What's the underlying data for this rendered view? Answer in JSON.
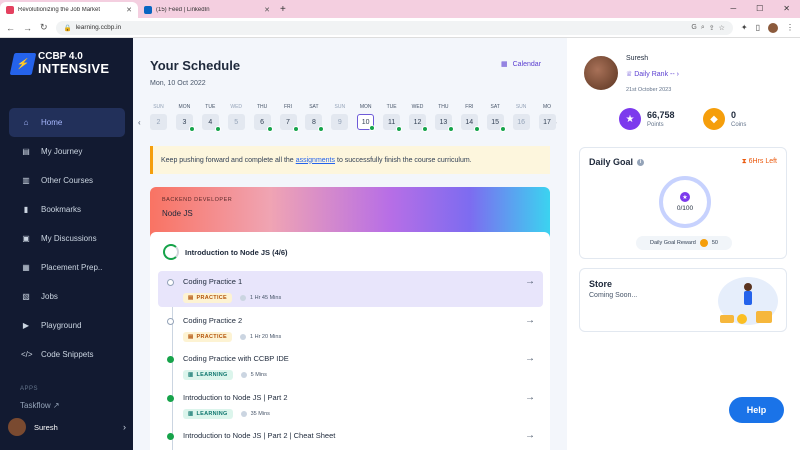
{
  "browser": {
    "tabs": [
      {
        "title": "Revolutionizing the Job Market",
        "active": true,
        "favicon_color": "#e4405f"
      },
      {
        "title": "(15) Feed | LinkedIn",
        "active": false,
        "favicon_color": "#0a66c2"
      }
    ],
    "url": "learning.ccbp.in"
  },
  "sidebar": {
    "logo": {
      "line1": "CCBP 4.0",
      "line2": "INTENSIVE"
    },
    "items": [
      {
        "label": "Home",
        "icon": "home-icon",
        "glyph": "⌂",
        "active": true
      },
      {
        "label": "My Journey",
        "icon": "journey-icon",
        "glyph": "▤"
      },
      {
        "label": "Other Courses",
        "icon": "book-icon",
        "glyph": "▥"
      },
      {
        "label": "Bookmarks",
        "icon": "bookmark-icon",
        "glyph": "▮"
      },
      {
        "label": "My Discussions",
        "icon": "chat-icon",
        "glyph": "▣"
      },
      {
        "label": "Placement Prep..",
        "icon": "placement-icon",
        "glyph": "▦"
      },
      {
        "label": "Jobs",
        "icon": "briefcase-icon",
        "glyph": "▧"
      },
      {
        "label": "Playground",
        "icon": "terminal-icon",
        "glyph": "▶"
      },
      {
        "label": "Code Snippets",
        "icon": "code-icon",
        "glyph": "</>"
      }
    ],
    "apps_label": "APPS",
    "apps_item": "Taskflow",
    "user": "Suresh"
  },
  "schedule": {
    "title": "Your Schedule",
    "date": "Mon, 10 Oct 2022",
    "calendar_label": "Calendar",
    "days": [
      {
        "dow": "SUN",
        "num": "2",
        "done": false,
        "dim": true
      },
      {
        "dow": "MON",
        "num": "3",
        "done": true
      },
      {
        "dow": "TUE",
        "num": "4",
        "done": true
      },
      {
        "dow": "WED",
        "num": "5",
        "done": false,
        "dim": true
      },
      {
        "dow": "THU",
        "num": "6",
        "done": true
      },
      {
        "dow": "FRI",
        "num": "7",
        "done": true
      },
      {
        "dow": "SAT",
        "num": "8",
        "done": true
      },
      {
        "dow": "SUN",
        "num": "9",
        "done": false,
        "dim": true
      },
      {
        "dow": "MON",
        "num": "10",
        "done": true,
        "today": true
      },
      {
        "dow": "TUE",
        "num": "11",
        "done": true
      },
      {
        "dow": "WED",
        "num": "12",
        "done": true
      },
      {
        "dow": "THU",
        "num": "13",
        "done": true
      },
      {
        "dow": "FRI",
        "num": "14",
        "done": true
      },
      {
        "dow": "SAT",
        "num": "15",
        "done": true
      },
      {
        "dow": "SUN",
        "num": "16",
        "done": false,
        "dim": true
      },
      {
        "dow": "MO",
        "num": "17",
        "done": false
      }
    ],
    "notice": {
      "before": "Keep pushing forward and complete all the",
      "link": "assignments",
      "after": "to successfully finish the course curriculum."
    }
  },
  "course": {
    "category": "BACKEND DEVELOPER",
    "name": "Node JS",
    "module": "Introduction to Node JS (4/6)",
    "items": [
      {
        "title": "Coding Practice 1",
        "tag": "PRACTICE",
        "type": "practice",
        "duration": "1 Hr 45 Mins",
        "status": "pending",
        "active": true
      },
      {
        "title": "Coding Practice 2",
        "tag": "PRACTICE",
        "type": "practice",
        "duration": "1 Hr 20 Mins",
        "status": "pending"
      },
      {
        "title": "Coding Practice with CCBP IDE",
        "tag": "LEARNING",
        "type": "learning",
        "duration": "5 Mins",
        "status": "done"
      },
      {
        "title": "Introduction to Node JS | Part 2",
        "tag": "LEARNING",
        "type": "learning",
        "duration": "35 Mins",
        "status": "done"
      },
      {
        "title": "Introduction to Node JS | Part 2 | Cheat Sheet",
        "tag": "",
        "type": "learning",
        "duration": "",
        "status": "done"
      }
    ]
  },
  "profile": {
    "name": "Suresh",
    "rank_label": "Daily Rank --",
    "date": "21st October 2023",
    "points": {
      "value": "66,758",
      "label": "Points"
    },
    "coins": {
      "value": "0",
      "label": "Coins"
    }
  },
  "daily_goal": {
    "title": "Daily Goal",
    "time_left": "6Hrs Left",
    "progress": "0/100",
    "reward_label": "Daily Goal Reward",
    "reward_value": "50"
  },
  "store": {
    "title": "Store",
    "subtitle": "Coming Soon..."
  },
  "help_label": "Help"
}
